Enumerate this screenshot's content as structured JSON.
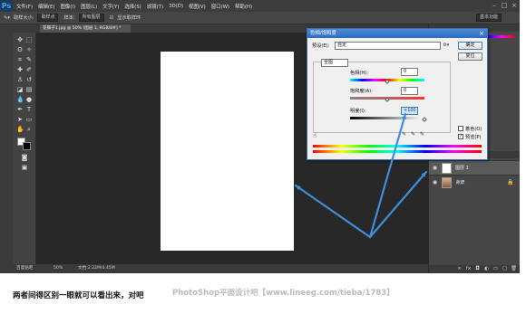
{
  "app": {
    "logo": "Ps"
  },
  "menu": [
    "文件(F)",
    "编辑(E)",
    "图像(I)",
    "图层(L)",
    "文字(Y)",
    "选择(S)",
    "滤镜(T)",
    "3D(D)",
    "视图(V)",
    "窗口(W)",
    "帮助(H)"
  ],
  "options": {
    "sample_label": "取样大小:",
    "sample_value": "取样点",
    "sample_layer_label": "样本:",
    "sample_layer_value": "所有图层",
    "ring_label": "显示取样环",
    "workspace": "基本功能"
  },
  "document": {
    "tab_title": "花钿子1.jpg @ 50% (图层 1, RGB/8#) *",
    "zoom": "50%",
    "info": "文档:2.22M/4.45M"
  },
  "layers": {
    "layer1_name": "图层 1",
    "background_name": "背景"
  },
  "dialog": {
    "title": "色相/饱和度",
    "preset_label": "预设(E):",
    "preset_value": "自定",
    "ok_label": "确定",
    "cancel_label": "复位",
    "channel_value": "全图",
    "hue_label": "色相(H):",
    "hue_value": "0",
    "saturation_label": "饱和度(A):",
    "saturation_value": "0",
    "lightness_label": "明度(I):",
    "lightness_value": "+100",
    "colorize_label": "着色(O)",
    "preview_label": "预览(P)",
    "hue_level": 0.5,
    "saturation_level": 0.5,
    "lightness_level": 1.0,
    "colors": {
      "titlebar": "#2d6cc0",
      "arrow": "#3e8edb"
    }
  },
  "caption": "两者间得区别一眼就可以看出来，对吧",
  "watermark": "PhotoShop平面设计吧【www.lineeg.com/tieba/1783】",
  "icons": {
    "bottom_left": "百度贴吧"
  }
}
